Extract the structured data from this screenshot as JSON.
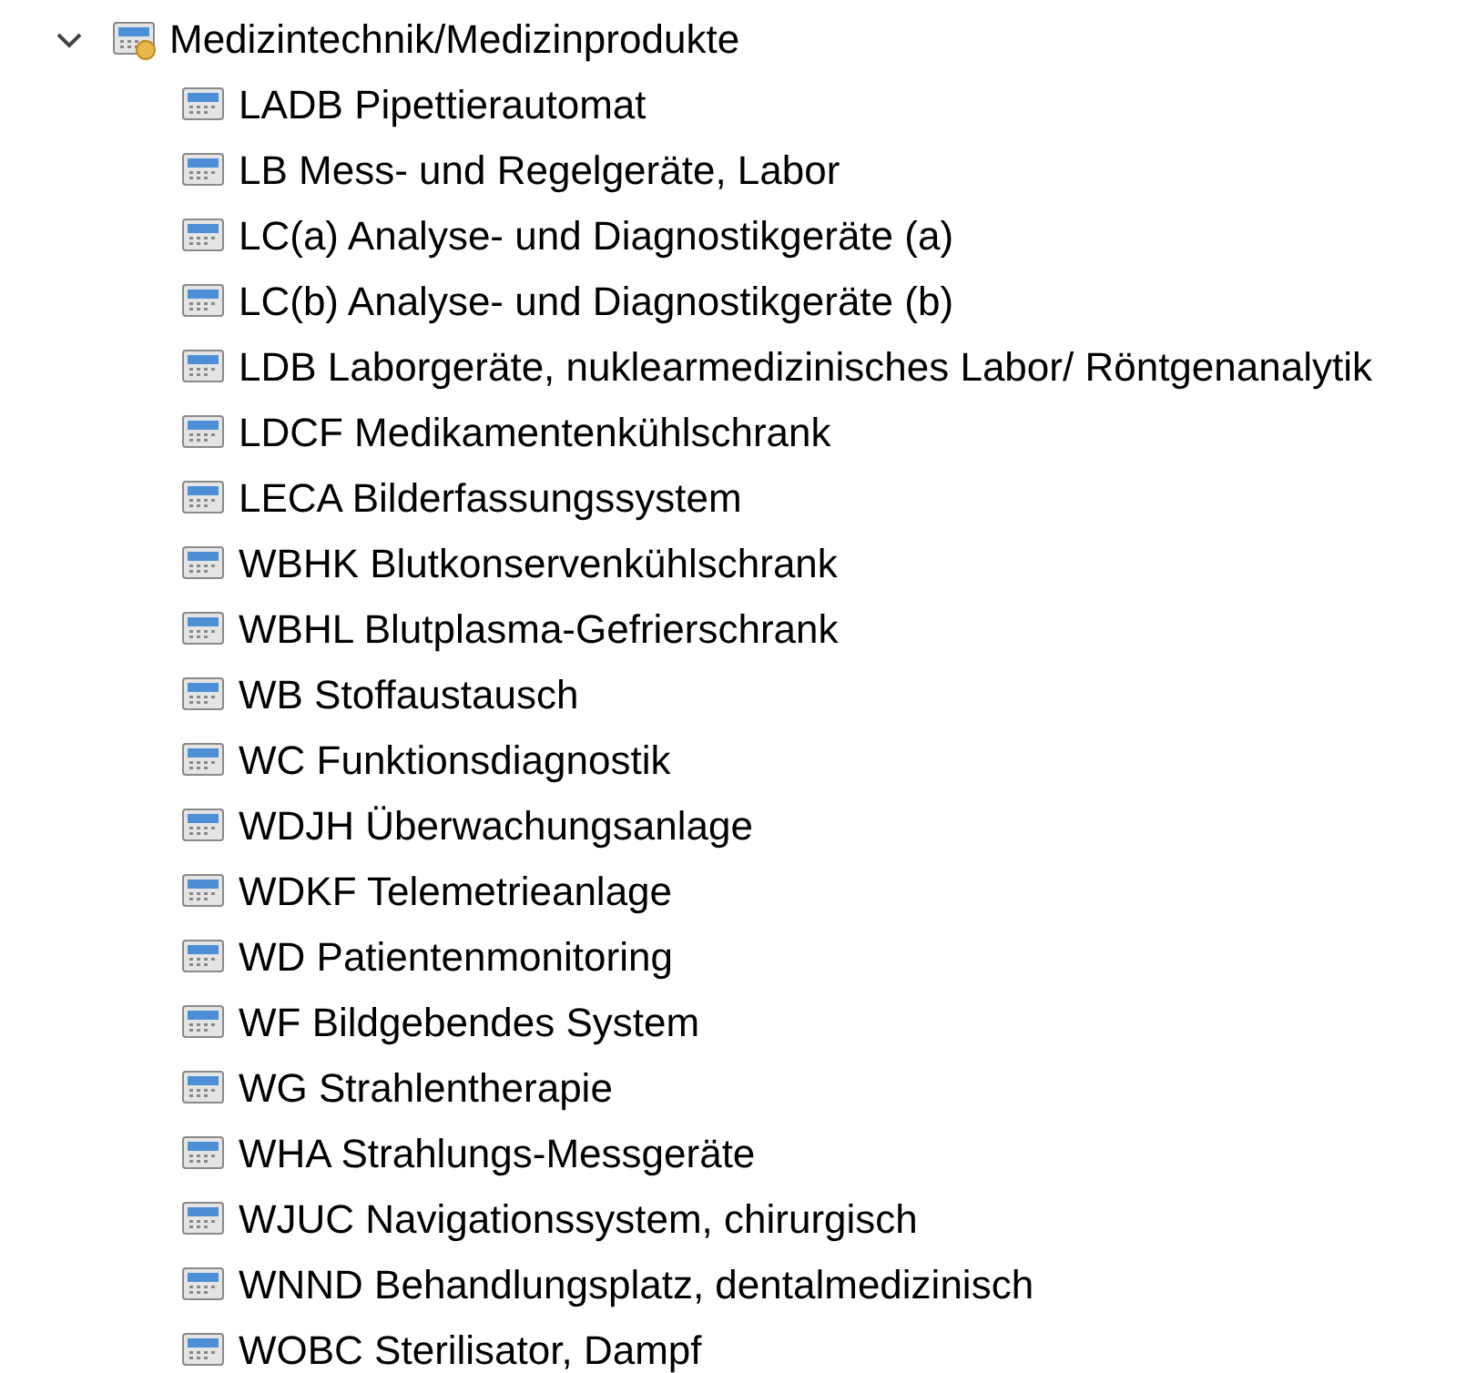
{
  "tree": {
    "label": "Medizintechnik/Medizinprodukte",
    "expanded": true,
    "children": [
      {
        "label": "LADB Pipettierautomat"
      },
      {
        "label": "LB Mess- und Regelgeräte, Labor"
      },
      {
        "label": "LC(a) Analyse- und Diagnostikgeräte (a)"
      },
      {
        "label": "LC(b) Analyse- und Diagnostikgeräte (b)"
      },
      {
        "label": "LDB Laborgeräte, nuklearmedizinisches Labor/ Röntgenanalytik"
      },
      {
        "label": "LDCF Medikamentenkühlschrank"
      },
      {
        "label": "LECA Bilderfassungssystem"
      },
      {
        "label": "WBHK Blutkonservenkühlschrank"
      },
      {
        "label": "WBHL Blutplasma-Gefrierschrank"
      },
      {
        "label": "WB Stoffaustausch"
      },
      {
        "label": "WC Funktionsdiagnostik"
      },
      {
        "label": "WDJH Überwachungsanlage"
      },
      {
        "label": "WDKF Telemetrieanlage"
      },
      {
        "label": "WD Patientenmonitoring"
      },
      {
        "label": "WF Bildgebendes System"
      },
      {
        "label": "WG Strahlentherapie"
      },
      {
        "label": "WHA Strahlungs-Messgeräte"
      },
      {
        "label": "WJUC Navigationssystem, chirurgisch"
      },
      {
        "label": "WNND Behandlungsplatz, dentalmedizinisch"
      },
      {
        "label": "WOBC Sterilisator, Dampf"
      }
    ]
  }
}
